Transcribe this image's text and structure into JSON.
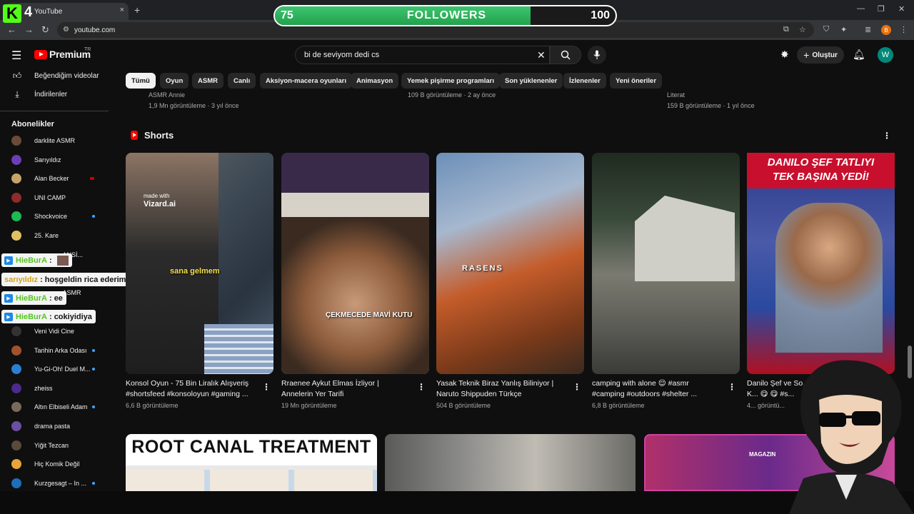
{
  "browser": {
    "tab_title": "YouTube",
    "tab_close": "×",
    "new_tab": "+",
    "url": "youtube.com",
    "minimize": "—",
    "maximize": "❐",
    "close": "✕",
    "back": "←",
    "forward": "→",
    "reload": "↻",
    "profile_initial": "B"
  },
  "overlay": {
    "kick_logo": "K",
    "kick_count": "4",
    "followers": {
      "start": "75",
      "label": "FOLLOWERS",
      "end": "100",
      "progress": 0.75
    }
  },
  "header": {
    "logo": "Premium",
    "region": "TR",
    "search_value": "bi de seviyom dedi cs",
    "create_label": "Oluştur",
    "avatar_initial": "W"
  },
  "sidebar": {
    "items": [
      {
        "label": "Beğendiğim videolar",
        "icon": "thumbs-up-icon"
      },
      {
        "label": "İndirilenler",
        "icon": "download-icon"
      }
    ],
    "subscriptions_title": "Abonelikler",
    "subscriptions": [
      {
        "name": "darklite ASMR",
        "color": "#6b4a3a",
        "dot": ""
      },
      {
        "name": "Sarıyıldız",
        "color": "#6a3fb5",
        "dot": ""
      },
      {
        "name": "Alan Becker",
        "color": "#c9a26b",
        "dot": "live"
      },
      {
        "name": "UNI CAMP",
        "color": "#8e2b2b",
        "dot": ""
      },
      {
        "name": "Shockvoice",
        "color": "#1db954",
        "dot": "new"
      },
      {
        "name": "25. Kare",
        "color": "#e0c060",
        "dot": ""
      },
      {
        "name": "Veni Vidi Cine",
        "color": "#333333",
        "dot": ""
      },
      {
        "name": "Tarihin Arka Odası",
        "color": "#a0522d",
        "dot": "new"
      },
      {
        "name": "Yu-Gi-Oh! Duel M...",
        "color": "#2a7fd4",
        "dot": "new"
      },
      {
        "name": "zheiss",
        "color": "#4b2a8a",
        "dot": ""
      },
      {
        "name": "Altın Elbiseli Adam",
        "color": "#7a6a5a",
        "dot": "new"
      },
      {
        "name": "drama pasta",
        "color": "#6b4fa0",
        "dot": ""
      },
      {
        "name": "Yiğit Tezcan",
        "color": "#5a4a3a",
        "dot": ""
      },
      {
        "name": "Hiç Komik Değil",
        "color": "#e8a33a",
        "dot": ""
      },
      {
        "name": "Kurzgesagt – In ...",
        "color": "#1e6fb8",
        "dot": "new"
      }
    ],
    "partial_names": [
      "...ANSİ...",
      "...ASMR"
    ]
  },
  "chat": [
    {
      "user": "HieBurA",
      "sep": ":",
      "msg": ""
    },
    {
      "user": "sarıyıldız",
      "sep": ":",
      "msg": "hoşgeldin rica ederim"
    },
    {
      "user": "HieBurA",
      "sep": ":",
      "msg": "ee"
    },
    {
      "user": "HieBurA",
      "sep": ":",
      "msg": "cokiyidiya"
    }
  ],
  "chips": [
    "Tümü",
    "Oyun",
    "ASMR",
    "Canlı",
    "Aksiyon-macera oyunları",
    "Animasyon",
    "Yemek pişirme programları",
    "Son yüklenenler",
    "İzlenenler",
    "Yeni öneriler"
  ],
  "top_row": {
    "channels": [
      "ASMR Annie",
      "Literat"
    ],
    "metas": [
      "1,9 Mn görüntüleme · 3 yıl önce",
      "109 B görüntüleme · 2 ay önce",
      "159 B görüntüleme · 1 yıl önce"
    ]
  },
  "shorts": {
    "title": "Shorts",
    "items": [
      {
        "title": "Konsol Oyun - 75 Bin Liralık Alışveriş #shortsfeed #konsoloyun #gaming ...",
        "views": "6,6 B görüntüleme",
        "caption": "sana gelmem",
        "badge": "made with",
        "badge2": "Vizard.ai"
      },
      {
        "title": "Rraenee Aykut Elmas İzliyor | Annelerin Yer Tarifi",
        "views": "19 Mn görüntüleme",
        "caption": "ÇEKMECEDE MAVİ KUTU"
      },
      {
        "title": "Yasak Teknik Biraz Yanlış Biliniyor | Naruto Shippuden Türkçe",
        "views": "504 B görüntüleme",
        "caption": "RASENS"
      },
      {
        "title": "camping with alone 😌 #asmr #camping #outdoors #shelter ...",
        "views": "6,8 B görüntüleme",
        "caption": ""
      },
      {
        "title": "Danilo Şef ve So... K... 😋 😋 #s...",
        "views": "4... görüntü...",
        "banner1": "DANILO ŞEF TATLIYI",
        "banner2": "TEK BAŞINA YEDİ!"
      }
    ]
  },
  "bottom": {
    "first_title": "ROOT CANAL TREATMENT",
    "third_badge": "MAGAZIN"
  }
}
